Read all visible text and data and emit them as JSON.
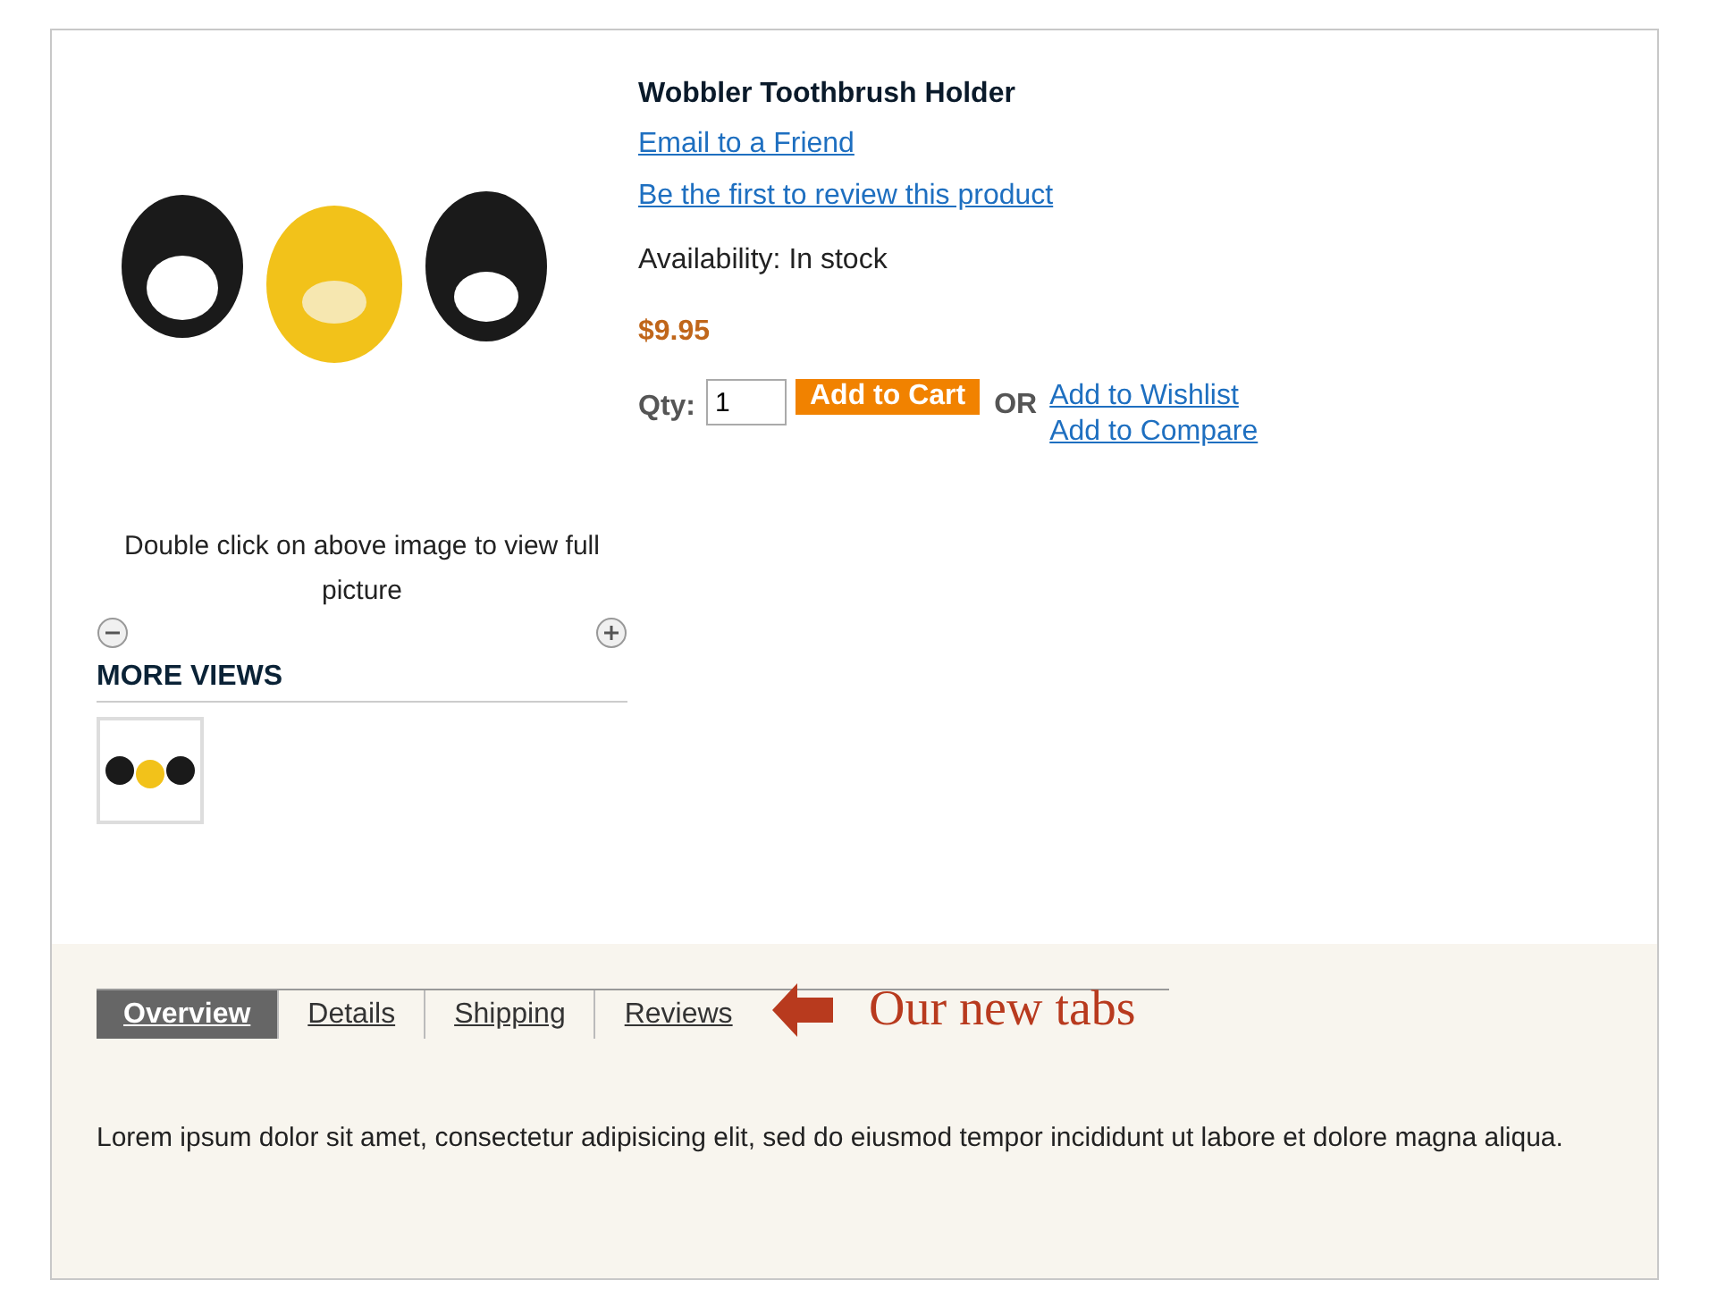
{
  "product": {
    "name": "Wobbler Toothbrush Holder",
    "links": [
      "Email to a Friend",
      "Be the first to review this product"
    ],
    "availability": "Availability: In stock",
    "price": "$9.95",
    "qty_label": "Qty:",
    "qty_value": "1",
    "add_to_cart": "Add to Cart",
    "or": "OR",
    "secondary_links": [
      "Add to Wishlist",
      "Add to Compare"
    ]
  },
  "image": {
    "caption": "Double click on above image to view full picture",
    "more_views": "MORE VIEWS"
  },
  "tabs": [
    {
      "label": "Overview",
      "selected": true
    },
    {
      "label": "Details",
      "selected": false
    },
    {
      "label": "Shipping",
      "selected": false
    },
    {
      "label": "Reviews",
      "selected": false
    }
  ],
  "annotation": "Our new tabs",
  "description": "Lorem ipsum dolor sit amet, consectetur adipisicing elit, sed do eiusmod tempor incididunt ut labore et dolore magna aliqua."
}
